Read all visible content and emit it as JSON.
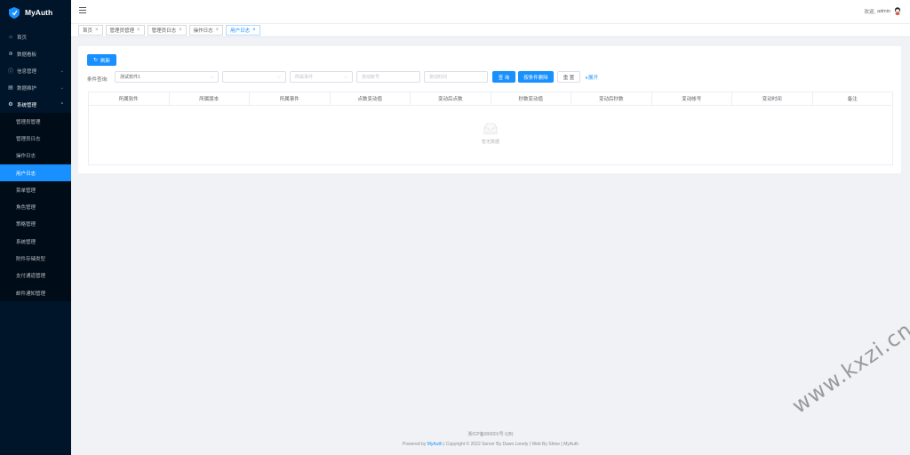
{
  "app": {
    "title": "MyAuth"
  },
  "sidebar": {
    "top_items": [
      {
        "label": "首页",
        "icon": "home-icon"
      },
      {
        "label": "数据看板",
        "icon": "dashboard-icon"
      },
      {
        "label": "信息管理",
        "icon": "info-icon",
        "has_children": true
      },
      {
        "label": "数据维护",
        "icon": "database-icon",
        "has_children": true
      },
      {
        "label": "系统管理",
        "icon": "gear-icon",
        "has_children": true,
        "open": true
      }
    ],
    "sub_items": [
      {
        "label": "管理员管理"
      },
      {
        "label": "管理员日志"
      },
      {
        "label": "操作日志"
      },
      {
        "label": "用户日志",
        "active": true
      },
      {
        "label": "菜单管理"
      },
      {
        "label": "角色管理"
      },
      {
        "label": "策略管理"
      },
      {
        "label": "系统管理"
      },
      {
        "label": "附件存储类型"
      },
      {
        "label": "支付通道管理"
      },
      {
        "label": "邮件通知管理"
      }
    ]
  },
  "header": {
    "welcome": "欢迎,",
    "username": "admin"
  },
  "tabs": [
    {
      "label": "首页"
    },
    {
      "label": "管理员管理"
    },
    {
      "label": "管理员日志"
    },
    {
      "label": "操作日志"
    },
    {
      "label": "用户日志",
      "active": true
    }
  ],
  "toolbar": {
    "refresh_label": "刷新"
  },
  "filters": {
    "label": "条件查询:",
    "software_value": "测试软件1",
    "version_placeholder": "",
    "event_placeholder": "所属事件",
    "account_placeholder": "变动帐号",
    "time_placeholder": "变动时间",
    "search_label": "查 询",
    "delete_label": "按条件删除",
    "reset_label": "重 置",
    "expand_label": "展开"
  },
  "table": {
    "columns": [
      "所属软件",
      "所属版本",
      "所属事件",
      "点数变动值",
      "变动后点数",
      "秒数变动值",
      "变动后秒数",
      "变动帐号",
      "变动时间",
      "备注"
    ],
    "empty_text": "暂无数据"
  },
  "footer": {
    "icp": "浙ICP备000001号-1(B)",
    "powered_prefix": "Powered by",
    "powered_link": "MyAuth",
    "copyright": "| Copyright © 2022 Server By Dawn.Lonely | Web By Shine | MyAuth"
  },
  "watermark": "www.kxzi.cn",
  "colors": {
    "sidebar_bg": "#001529",
    "primary": "#1890ff",
    "page_bg": "#f0f2f5"
  }
}
